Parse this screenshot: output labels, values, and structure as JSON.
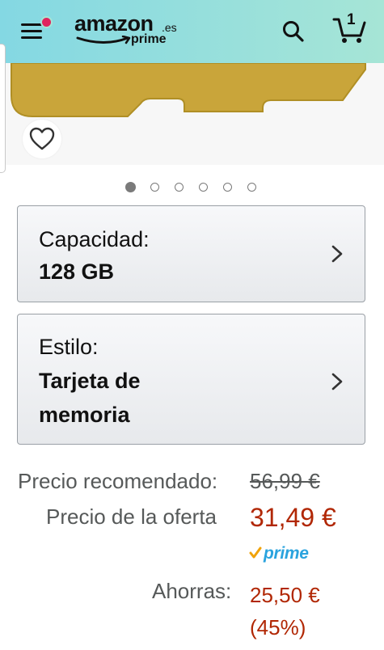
{
  "header": {
    "logo_text": "amazon",
    "logo_suffix": ".es",
    "logo_prime": "prime",
    "cart_count": "1",
    "icons": [
      "menu-icon",
      "notification-dot",
      "search-icon",
      "cart-icon"
    ],
    "colors": {
      "header_start": "#84d8e3",
      "header_end": "#a6e5d6",
      "notification": "#e0245e"
    }
  },
  "gallery": {
    "wishlist_icon": "heart-icon",
    "dots_count": 6,
    "active_dot": 0
  },
  "variations": [
    {
      "label": "Capacidad:",
      "value_lines": [
        "128 GB"
      ]
    },
    {
      "label": "Estilo:",
      "value_lines": [
        "Tarjeta de",
        "memoria"
      ]
    }
  ],
  "pricing": {
    "recommended_label": "Precio recomendado:",
    "recommended_value": "56,99 €",
    "offer_label": "Precio de la oferta",
    "offer_value": "31,49 €",
    "prime_label": "prime",
    "savings_label": "Ahorras:",
    "savings_value": "25,50 €",
    "savings_percent": "(45%)",
    "colors": {
      "price_red": "#b12704",
      "label_gray": "#565959",
      "prime_blue": "#2aa3de"
    }
  }
}
